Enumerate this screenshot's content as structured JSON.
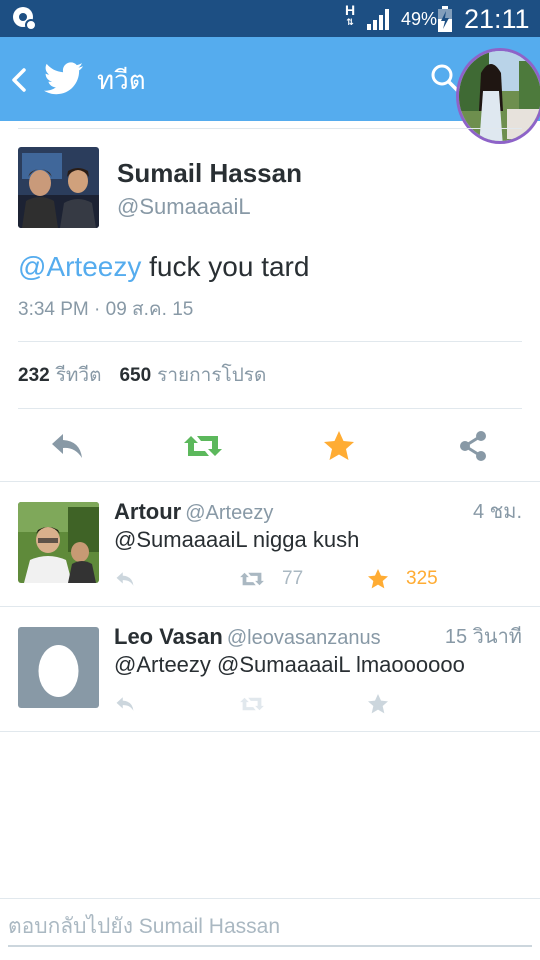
{
  "status_bar": {
    "network_label": "H",
    "battery_percent": "49%",
    "time": "21:11"
  },
  "app_bar": {
    "title": "ทวีต"
  },
  "tweet": {
    "author_name": "Sumail Hassan",
    "author_handle": "@SumaaaaiL",
    "mention": "@Arteezy",
    "text": " fuck you tard",
    "timestamp": "3:34 PM · 09 ส.ค. 15",
    "retweet_count": "232",
    "retweet_label": "รีทวีต",
    "favorite_count": "650",
    "favorite_label": "รายการโปรด"
  },
  "replies": [
    {
      "name": "Artour",
      "handle": "@Arteezy",
      "time": "4 ชม.",
      "text": "@SumaaaaiL nigga kush",
      "retweets": "77",
      "favorites": "325"
    },
    {
      "name": "Leo Vasan",
      "handle": "@leovasanzanus",
      "time": "15 วินาที",
      "text": "@Arteezy @SumaaaaiL lmaoooooo",
      "retweets": "",
      "favorites": ""
    }
  ],
  "compose": {
    "placeholder": "ตอบกลับไปยัง Sumail Hassan"
  },
  "colors": {
    "status_bar": "#1d4f83",
    "app_bar": "#55acee",
    "retweet_green": "#5cb85c",
    "favorite_orange": "#ffac33",
    "muted_icon": "#8899a6"
  }
}
